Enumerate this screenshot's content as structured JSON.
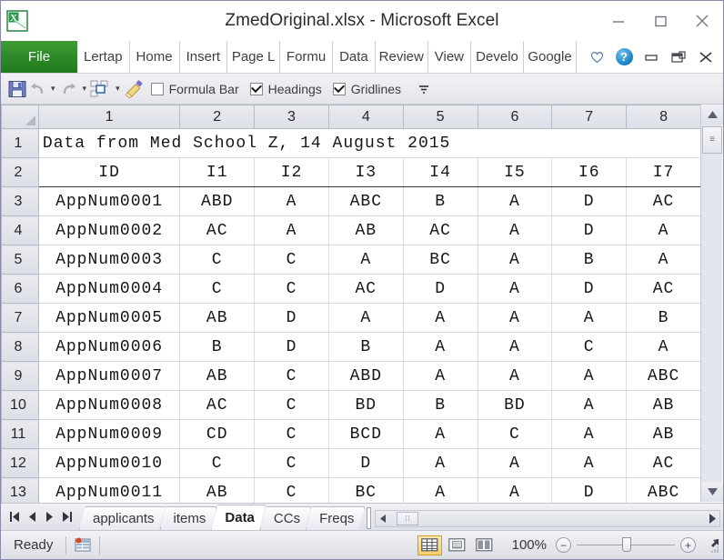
{
  "window": {
    "title": "ZmedOriginal.xlsx  -  Microsoft Excel",
    "app_icon": "excel-icon",
    "minimize_label": "Minimize",
    "maximize_label": "Maximize",
    "close_label": "Close"
  },
  "ribbon": {
    "file_tab": "File",
    "tabs": [
      "Lertap",
      "Home",
      "Insert",
      "Page L",
      "Formu",
      "Data",
      "Review",
      "View",
      "Develo",
      "Google"
    ],
    "right_icons": [
      "heart-icon",
      "help-icon",
      "ribbon-minimize-icon",
      "ribbon-restore-icon",
      "ribbon-close-icon"
    ],
    "help_glyph": "?"
  },
  "qat": {
    "icons": [
      "save-icon",
      "undo-icon",
      "undo-dropdown-icon",
      "redo-icon",
      "redo-dropdown-icon",
      "customize-icon",
      "customize-dropdown-icon",
      "format-painter-icon"
    ],
    "checkboxes": [
      {
        "label": "Formula Bar",
        "checked": false
      },
      {
        "label": "Headings",
        "checked": true
      },
      {
        "label": "Gridlines",
        "checked": true
      }
    ],
    "overflow_glyph": "☰"
  },
  "grid": {
    "corner": "select-all",
    "column_headers": [
      "1",
      "2",
      "3",
      "4",
      "5",
      "6",
      "7",
      "8"
    ],
    "row_numbers": [
      "1",
      "2",
      "3",
      "4",
      "5",
      "6",
      "7",
      "8",
      "9",
      "10",
      "11",
      "12",
      "13"
    ],
    "title_row": {
      "number": "1",
      "text": "Data from Med School Z, 14 August 2015"
    },
    "header_row": {
      "number": "2",
      "cells": [
        "ID",
        "I1",
        "I2",
        "I3",
        "I4",
        "I5",
        "I6",
        "I7"
      ]
    },
    "rows": [
      {
        "number": "3",
        "cells": [
          "AppNum0001",
          "ABD",
          "A",
          "ABC",
          "B",
          "A",
          "D",
          "AC"
        ]
      },
      {
        "number": "4",
        "cells": [
          "AppNum0002",
          "AC",
          "A",
          "AB",
          "AC",
          "A",
          "D",
          "A"
        ]
      },
      {
        "number": "5",
        "cells": [
          "AppNum0003",
          "C",
          "C",
          "A",
          "BC",
          "A",
          "B",
          "A"
        ]
      },
      {
        "number": "6",
        "cells": [
          "AppNum0004",
          "C",
          "C",
          "AC",
          "D",
          "A",
          "D",
          "AC"
        ]
      },
      {
        "number": "7",
        "cells": [
          "AppNum0005",
          "AB",
          "D",
          "A",
          "A",
          "A",
          "A",
          "B"
        ]
      },
      {
        "number": "8",
        "cells": [
          "AppNum0006",
          "B",
          "D",
          "B",
          "A",
          "A",
          "C",
          "A"
        ]
      },
      {
        "number": "9",
        "cells": [
          "AppNum0007",
          "AB",
          "C",
          "ABD",
          "A",
          "A",
          "A",
          "ABC"
        ]
      },
      {
        "number": "10",
        "cells": [
          "AppNum0008",
          "AC",
          "C",
          "BD",
          "B",
          "BD",
          "A",
          "AB"
        ]
      },
      {
        "number": "11",
        "cells": [
          "AppNum0009",
          "CD",
          "C",
          "BCD",
          "A",
          "C",
          "A",
          "AB"
        ]
      },
      {
        "number": "12",
        "cells": [
          "AppNum0010",
          "C",
          "C",
          "D",
          "A",
          "A",
          "A",
          "AC"
        ]
      },
      {
        "number": "13",
        "cells": [
          "AppNum0011",
          "AB",
          "C",
          "BC",
          "A",
          "A",
          "D",
          "ABC"
        ]
      }
    ]
  },
  "sheet_tabs": {
    "nav": [
      "first-sheet",
      "prev-sheet",
      "next-sheet",
      "last-sheet"
    ],
    "tabs": [
      "applicants",
      "items",
      "Data",
      "CCs",
      "Freqs"
    ],
    "active": "Data"
  },
  "status": {
    "mode": "Ready",
    "macro_icon": "record-macro-icon",
    "view_buttons": [
      "normal-view",
      "page-layout-view",
      "page-break-view"
    ],
    "active_view": "normal-view",
    "zoom": "100%",
    "zoom_out": "−",
    "zoom_in": "+"
  },
  "colors": {
    "file_tab_green": "#2e8b28",
    "window_border": "#8a8aa8",
    "header_gray": "#dcdfe6",
    "selected_view": "#f7ce6d"
  }
}
